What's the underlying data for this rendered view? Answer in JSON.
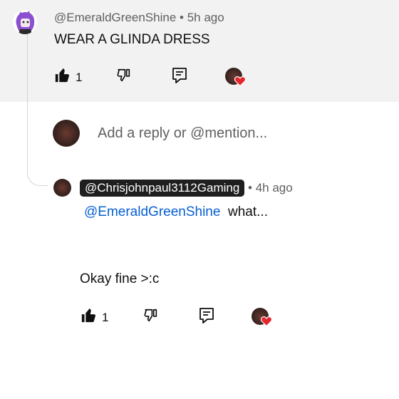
{
  "comment": {
    "author": "@EmeraldGreenShine",
    "separator": "•",
    "time": "5h ago",
    "text": "WEAR A GLINDA DRESS",
    "like_count": "1"
  },
  "reply_box": {
    "placeholder": "Add a reply or @mention..."
  },
  "reply": {
    "author": "@Chrisjohnpaul3112Gaming",
    "separator": "•",
    "time": "4h ago",
    "mention": "@EmeraldGreenShine",
    "text_after_mention": "what...",
    "second_line": "Okay fine >:c",
    "like_count": "1"
  },
  "icons": {
    "like": "thumbs-up-icon",
    "dislike": "thumbs-down-icon",
    "reply": "reply-comment-icon",
    "creator_heart": "creator-heart-icon"
  },
  "colors": {
    "mention": "#065fd4",
    "heart": "#e4262f",
    "author_chip_bg": "#1f1f1f"
  }
}
